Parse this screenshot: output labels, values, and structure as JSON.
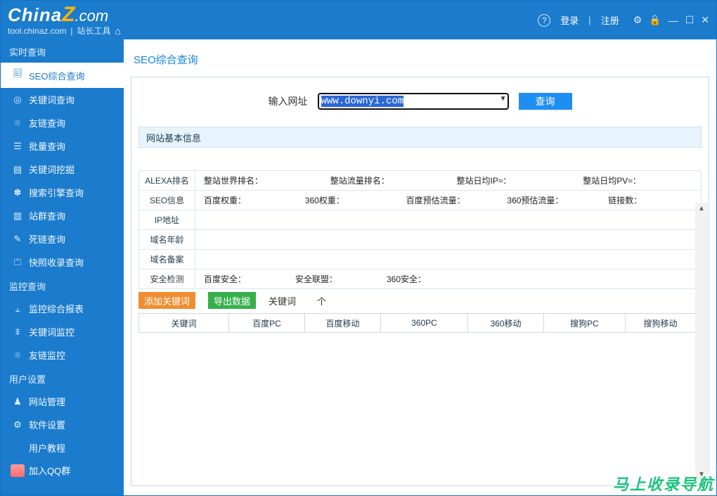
{
  "brand": {
    "part1": "China",
    "part2": "Z",
    "part3": ".com",
    "sub": "tool.chinaz.com",
    "sub2": "站长工具"
  },
  "title_right": {
    "login": "登录",
    "register": "注册"
  },
  "sidebar": {
    "group1": "实时查询",
    "group2": "监控查询",
    "group3": "用户设置",
    "items1": [
      "SEO综合查询",
      "关键词查询",
      "友链查询",
      "批量查询",
      "关键词挖掘",
      "搜索引擎查询",
      "站群查询",
      "死链查询",
      "快照收录查询"
    ],
    "items2": [
      "监控综合报表",
      "关键词监控",
      "友链监控"
    ],
    "items3": [
      "网站管理",
      "软件设置",
      "用户教程"
    ],
    "qq": "加入QQ群"
  },
  "page": {
    "title": "SEO综合查询",
    "input_label": "输入网址",
    "url_value": "www.downyi.com",
    "query_btn": "查询",
    "section_basic": "网站基本信息",
    "rows": {
      "alexa_label": "ALEXA排名",
      "alexa_cells": [
        "整站世界排名：",
        "整站流量排名：",
        "整站日均IP≈：",
        "整站日均PV≈："
      ],
      "seo_label": "SEO信息",
      "seo_cells": [
        "百度权重：",
        "360权重：",
        "百度预估流量：",
        "360预估流量：",
        "链接数："
      ],
      "ip_label": "IP地址",
      "age_label": "域名年龄",
      "rec_label": "域名备案",
      "safe_label": "安全检测",
      "safe_cells": [
        "百度安全：",
        "安全联盟：",
        "360安全："
      ]
    },
    "actions": {
      "add_kw": "添加关键词",
      "export": "导出数据",
      "kw_word": "关键词",
      "kw_count_suffix": "个"
    },
    "table_cols": [
      "关键词",
      "百度PC",
      "百度移动",
      "360PC",
      "360移动",
      "搜狗PC",
      "搜狗移动"
    ]
  },
  "overlay": "马上收录导航"
}
